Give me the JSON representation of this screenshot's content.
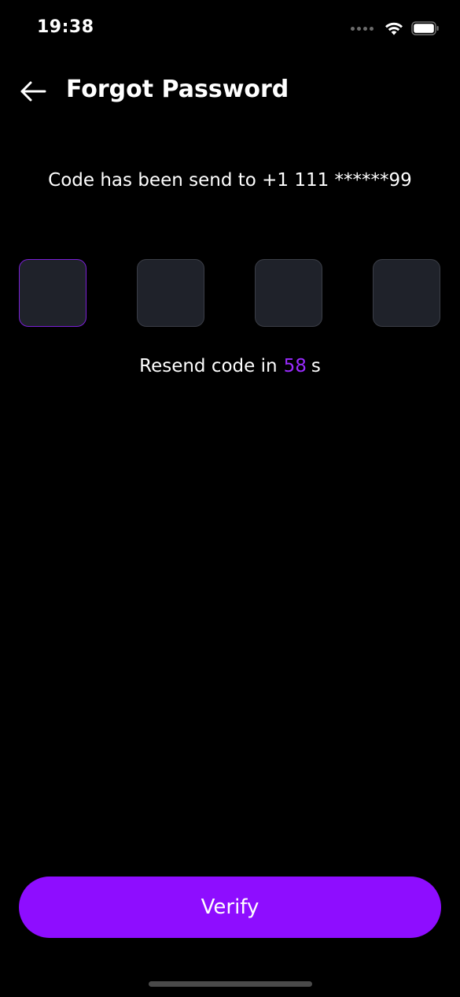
{
  "status_bar": {
    "time": "19:38"
  },
  "header": {
    "back_icon": "arrow-left-icon",
    "title": "Forgot Password"
  },
  "message": {
    "text": "Code has been send to +1 111 ******99"
  },
  "otp": {
    "digits": [
      "",
      "",
      "",
      ""
    ],
    "active_index": 0
  },
  "resend": {
    "prefix": "Resend code in",
    "count": "58",
    "suffix": "s"
  },
  "verify_button": {
    "label": "Verify"
  },
  "colors": {
    "background": "#000000",
    "accent": "#8e0dff",
    "countdown": "#9a2bff",
    "otp_box": "#1f222a",
    "otp_border": "#3b3e47",
    "otp_active_border": "#7a1fd6"
  }
}
